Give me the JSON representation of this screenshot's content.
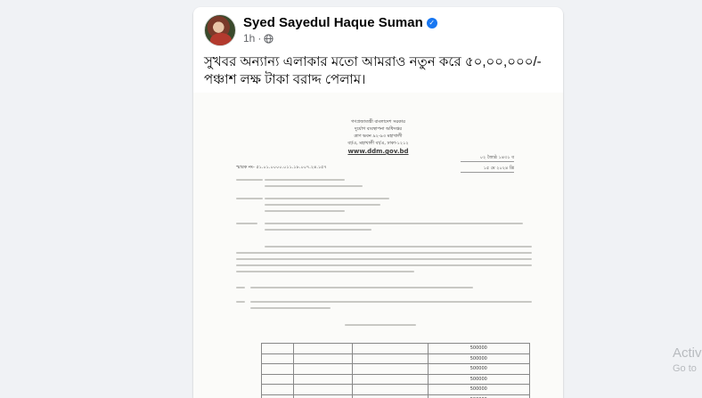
{
  "post": {
    "author": "Syed Sayedul Haque Suman",
    "time": "1h",
    "separator": "·",
    "text": "সুখবর অন্যান্য এলাকার মতো আমরাও নতুন করে ৫০,০০,০০০/- পঞ্চাশ লক্ষ টাকা বরাদ্দ পেলাম।"
  },
  "document": {
    "header_lines": [
      "গণপ্রজাতন্ত্রী বাংলাদেশ সরকার",
      "দুর্যোগ ব্যবস্থাপনা অধিদপ্তর",
      "ত্রাণ ভবন ৯২-৯৩ মহাখালী",
      "বা/এ, মহাখালী বা/এ, ঢাকা-১২১২"
    ],
    "website": "www.ddm.gov.bd",
    "ref_no": "স্মারক নং- ৫১.০১.০০০০.০১১.১৮.০০৭.২৪.১৫৭",
    "dates": [
      "০২ জ্যৈষ্ঠ ১৪৩১ ব",
      "১৫ মে ২০২৪ খ্রি"
    ],
    "table_values": [
      "500000",
      "500000",
      "500000",
      "500000",
      "500000",
      "500000"
    ]
  },
  "overlay": {
    "activate": "Activ",
    "goto": "Go to"
  },
  "colors": {
    "page_bg": "#f0f2f5",
    "card_bg": "#ffffff",
    "verified": "#1877f2"
  }
}
